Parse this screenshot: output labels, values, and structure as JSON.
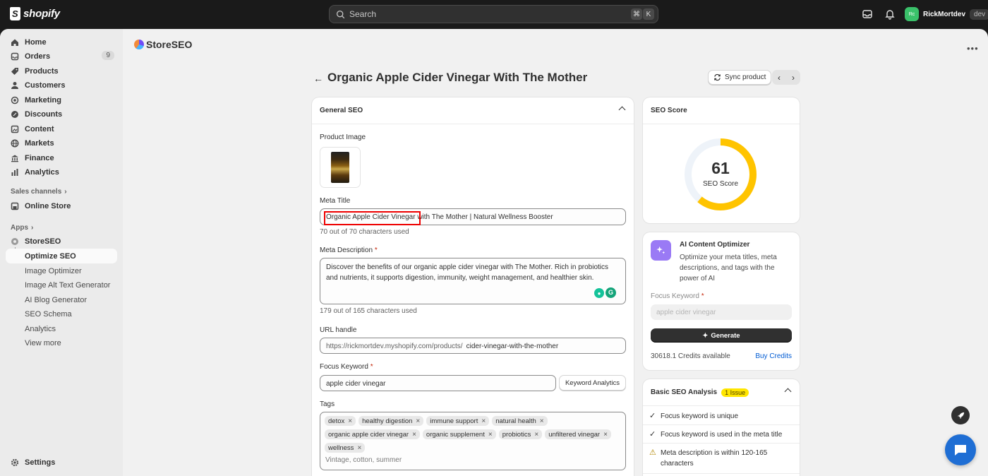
{
  "topbar": {
    "brand": "shopify",
    "search_placeholder": "Search",
    "shortcut_key1": "⌘",
    "shortcut_key2": "K",
    "user_initials": "Rc",
    "user_name": "RickMortdev",
    "env_badge": "dev"
  },
  "sidebar": {
    "items": [
      {
        "label": "Home",
        "icon": "home-icon"
      },
      {
        "label": "Orders",
        "icon": "orders-icon",
        "badge": "9"
      },
      {
        "label": "Products",
        "icon": "products-icon"
      },
      {
        "label": "Customers",
        "icon": "customers-icon"
      },
      {
        "label": "Marketing",
        "icon": "marketing-icon"
      },
      {
        "label": "Discounts",
        "icon": "discounts-icon"
      },
      {
        "label": "Content",
        "icon": "content-icon"
      },
      {
        "label": "Markets",
        "icon": "markets-icon"
      },
      {
        "label": "Finance",
        "icon": "finance-icon"
      },
      {
        "label": "Analytics",
        "icon": "analytics-icon"
      }
    ],
    "sales_channels_label": "Sales channels",
    "online_store": "Online Store",
    "apps_label": "Apps",
    "app_name": "StoreSEO",
    "app_subitems": [
      "Optimize SEO",
      "Image Optimizer",
      "Image Alt Text Generator",
      "AI Blog Generator",
      "SEO Schema",
      "Analytics",
      "View more"
    ],
    "settings": "Settings"
  },
  "app": {
    "title": "StoreSEO"
  },
  "page": {
    "title": "Organic Apple Cider Vinegar With The Mother",
    "sync_button": "Sync product"
  },
  "general_seo": {
    "heading": "General SEO",
    "product_image_label": "Product Image",
    "meta_title_label": "Meta Title",
    "meta_title_value": "Organic Apple Cider Vinegar with The Mother | Natural Wellness Booster",
    "meta_title_help": "70 out of 70 characters used",
    "meta_desc_label": "Meta Description",
    "meta_desc_value": "Discover the benefits of our organic apple cider vinegar with The Mother. Rich in probiotics and nutrients, it supports digestion, immunity, weight management, and healthier skin.",
    "meta_desc_help": "179 out of 165 characters used",
    "url_label": "URL handle",
    "url_prefix": "https://rickmortdev.myshopify.com/products/",
    "url_value": "cider-vinegar-with-the-mother",
    "focus_label": "Focus Keyword",
    "focus_value": "apple cider vinegar",
    "keyword_analytics": "Keyword Analytics",
    "tags_label": "Tags",
    "tags": [
      "detox",
      "healthy digestion",
      "immune support",
      "natural health",
      "organic apple cider vinegar",
      "organic supplement",
      "probiotics",
      "unfiltered vinegar",
      "wellness"
    ],
    "tags_placeholder": "Vintage, cotton, summer"
  },
  "seo_score": {
    "heading": "SEO Score",
    "value": "61",
    "label": "SEO Score",
    "fraction": 0.61,
    "color": "#ffc400"
  },
  "ai_optimizer": {
    "title": "AI Content Optimizer",
    "desc": "Optimize your meta titles, meta descriptions, and tags with the power of AI",
    "focus_label": "Focus Keyword",
    "focus_placeholder": "apple cider vinegar",
    "generate": "Generate",
    "credits": "30618.1 Credits available",
    "buy": "Buy Credits"
  },
  "analysis": {
    "heading": "Basic SEO Analysis",
    "badge": "1 Issue",
    "rows": [
      {
        "text": "Focus keyword is unique",
        "status": "pass"
      },
      {
        "text": "Focus keyword is used in the meta title",
        "status": "pass"
      },
      {
        "text": "Meta description is within 120-165 characters",
        "status": "warn"
      }
    ]
  }
}
